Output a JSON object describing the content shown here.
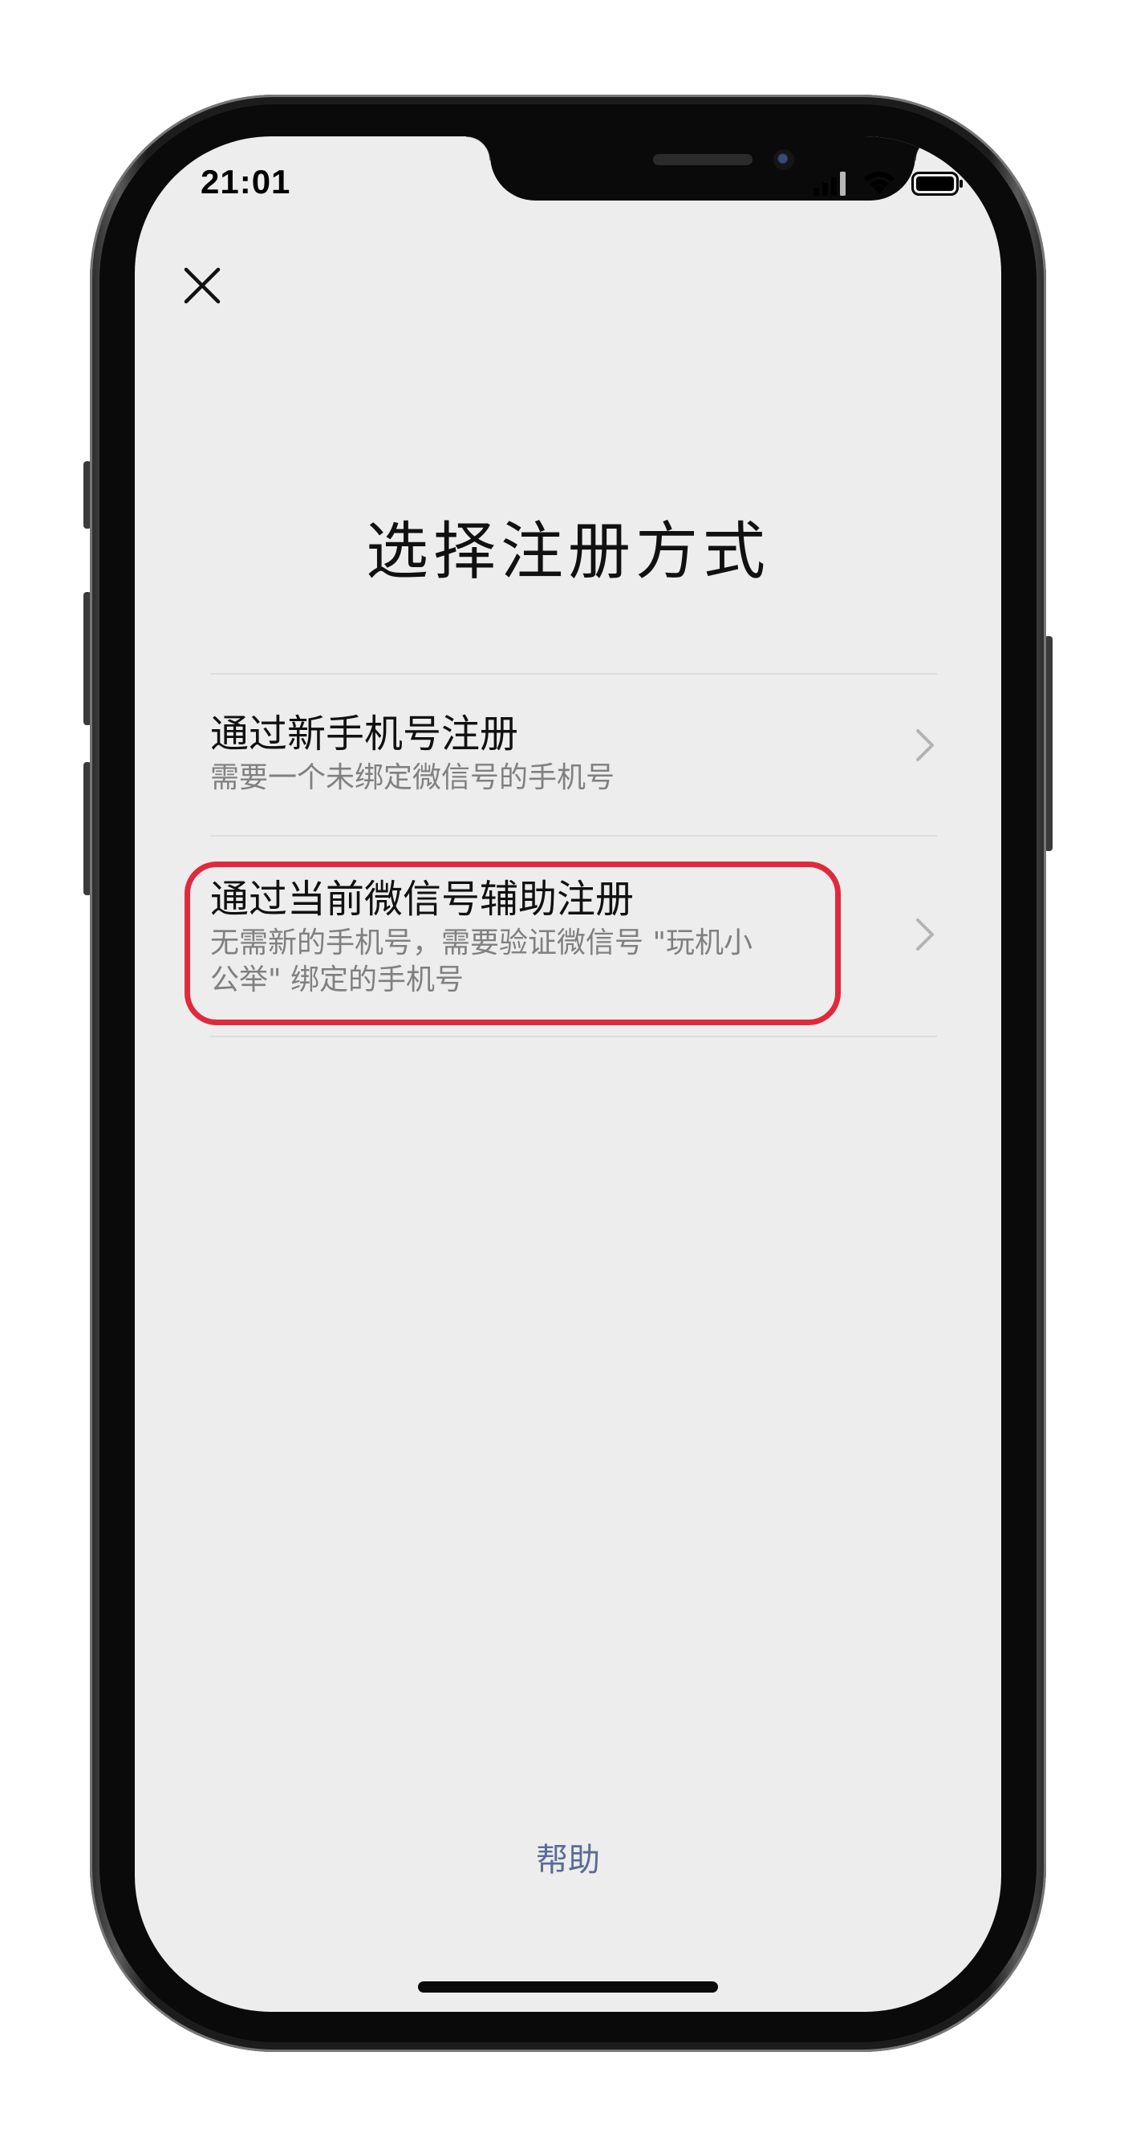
{
  "status_bar": {
    "time": "21:01",
    "icons": [
      "signal-icon",
      "wifi-icon",
      "battery-icon"
    ]
  },
  "header": {
    "close_icon": "close-icon"
  },
  "page": {
    "title": "选择注册方式"
  },
  "options": [
    {
      "title": "通过新手机号注册",
      "subtitle_lines": [
        "需要一个未绑定微信号的手机号"
      ],
      "icon": "chevron-right-icon"
    },
    {
      "title": "通过当前微信号辅助注册",
      "subtitle_lines": [
        "无需新的手机号，需要验证微信号 \"玩机小",
        "公举\" 绑定的手机号"
      ],
      "icon": "chevron-right-icon",
      "highlighted": true
    }
  ],
  "footer": {
    "help_label": "帮助"
  },
  "colors": {
    "screen_background": "#ededed",
    "title_text": "#111111",
    "subtitle_text": "#808080",
    "link_text": "#5a6b95",
    "highlight_border": "#e02a3c"
  }
}
